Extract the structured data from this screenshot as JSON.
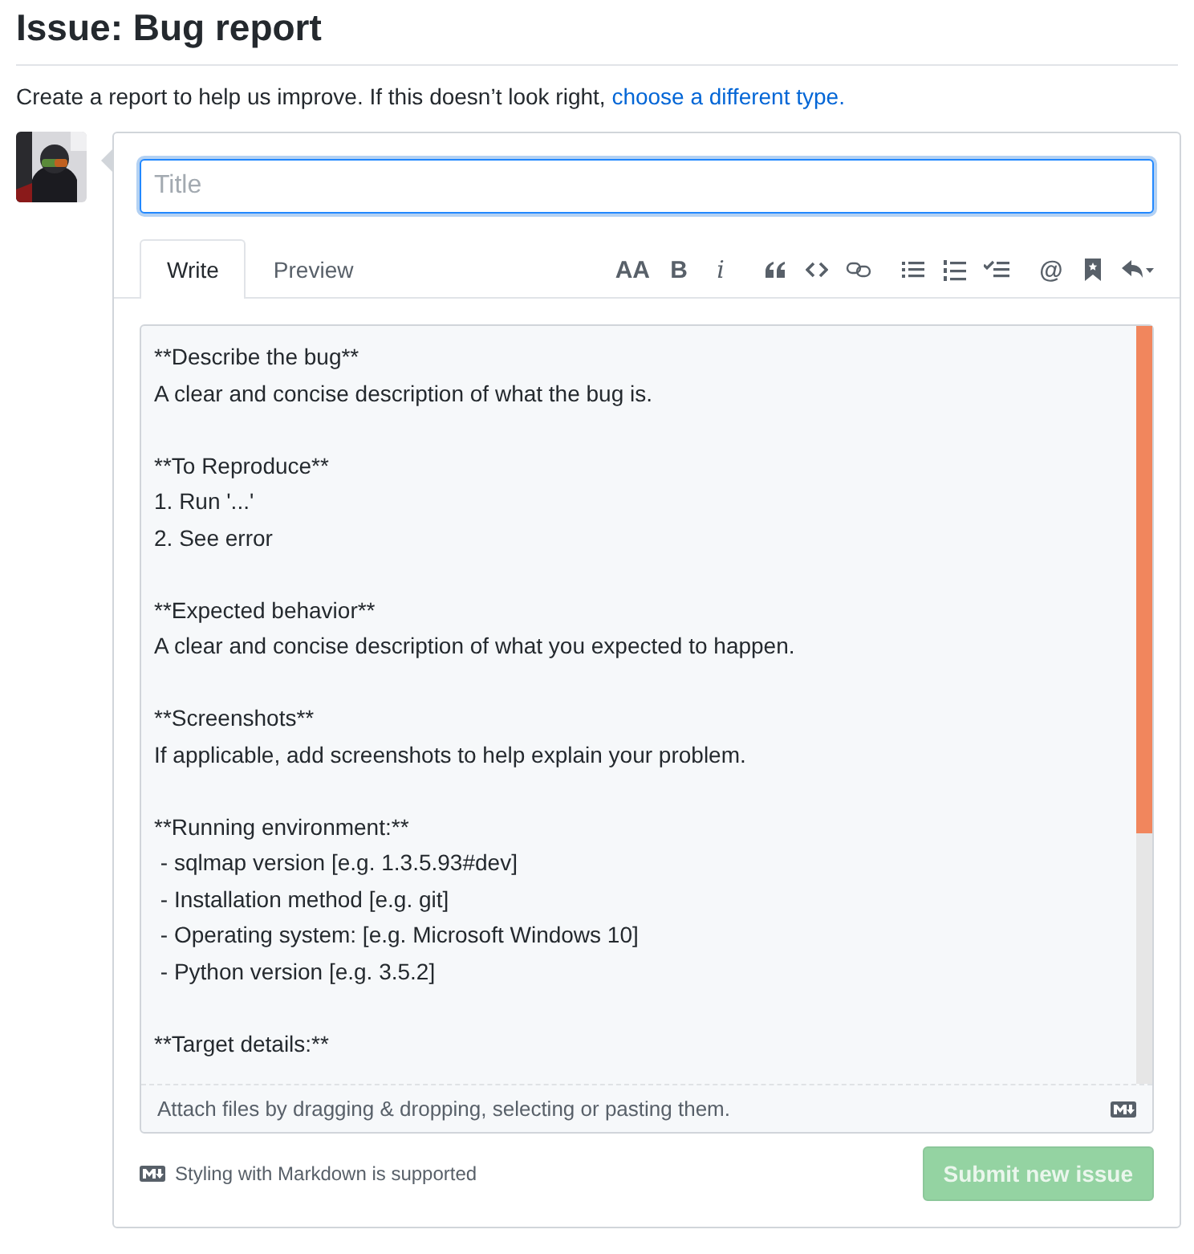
{
  "page_title": "Issue: Bug report",
  "intro": {
    "text": "Create a report to help us improve. If this doesn’t look right,",
    "link": "choose a different type."
  },
  "avatar": {
    "kind": "picture"
  },
  "title_field": {
    "placeholder": "Title"
  },
  "tabs": [
    {
      "label": "Write",
      "selected": true
    },
    {
      "label": "Preview",
      "selected": false
    }
  ],
  "toolbar": [
    [
      {
        "kind": "glyph",
        "label": "AA"
      },
      {
        "kind": "glyph",
        "label": "B"
      },
      {
        "kind": "italic",
        "label": "i"
      }
    ],
    [
      {
        "kind": "quote"
      },
      {
        "kind": "code"
      },
      {
        "kind": "link"
      }
    ],
    [
      {
        "kind": "bullets"
      },
      {
        "kind": "numbers"
      },
      {
        "kind": "tasks"
      }
    ],
    [
      {
        "kind": "glyph",
        "label": "@"
      },
      {
        "kind": "bookmark"
      },
      {
        "kind": "reply"
      }
    ]
  ],
  "body_text": "**Describe the bug**\nA clear and concise description of what the bug is.\n\n**To Reproduce**\n1. Run '...'\n2. See error\n\n**Expected behavior**\nA clear and concise description of what you expected to happen.\n\n**Screenshots**\nIf applicable, add screenshots to help explain your problem.\n\n**Running environment:**\n - sqlmap version [e.g. 1.3.5.93#dev]\n - Installation method [e.g. git]\n - Operating system: [e.g. Microsoft Windows 10]\n - Python version [e.g. 3.5.2]\n\n**Target details:**",
  "attach_hint": "Attach files by dragging & dropping, selecting or pasting them.",
  "markdown_note": "Styling with Markdown is supported",
  "submit": {
    "label": "Submit new issue",
    "disabled": true
  }
}
